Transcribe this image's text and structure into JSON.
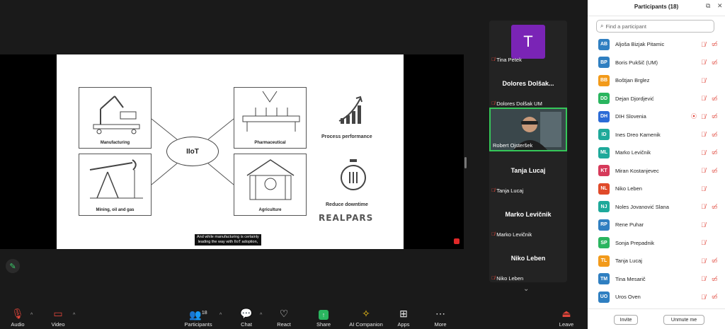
{
  "slide": {
    "boxes": [
      "Manufacturing",
      "Pharmaceutical",
      "Mining, oil and gas",
      "Agriculture"
    ],
    "center": "IIoT",
    "side": [
      "Process performance",
      "Reduce downtime"
    ],
    "brand": "REALPARS",
    "caption_line1": "And while manufacturing is certainly",
    "caption_line2": "leading the way with IIoT adoption,"
  },
  "gallery": {
    "tiles": [
      {
        "avatar": "T",
        "label": "Tina Petek"
      },
      {
        "name": "Dolores  Dolšak...",
        "label": "Dolores Dolšak UM"
      },
      {
        "label": "Robert Ojsteršek"
      },
      {
        "name": "Tanja Lucaj",
        "label": "Tanja Lucaj"
      },
      {
        "name": "Marko Levičnik",
        "label": "Marko Levičnik"
      },
      {
        "name": "Niko Leben",
        "label": "Niko Leben"
      }
    ]
  },
  "toolbar": {
    "audio": "Audio",
    "video": "Video",
    "participants": "Participants",
    "participants_count": "18",
    "chat": "Chat",
    "react": "React",
    "share": "Share",
    "ai": "AI Companion",
    "apps": "Apps",
    "more": "More",
    "leave": "Leave"
  },
  "panel": {
    "title": "Participants (18)",
    "search_placeholder": "Find a participant",
    "invite": "Invite",
    "unmute": "Unmute me",
    "participants": [
      {
        "initials": "AB",
        "name": "Aljoša Bizjak Pitamic",
        "color": "#2f7fc1",
        "cam_off": true
      },
      {
        "initials": "BP",
        "name": "Boris Pukšič (UM)",
        "color": "#2f7fc1",
        "cam_off": true
      },
      {
        "initials": "BB",
        "name": "Boštjan Brglez",
        "color": "#f29a1a",
        "cam_off": false
      },
      {
        "initials": "DD",
        "name": "Dejan Djordjević",
        "color": "#2ab55f",
        "cam_off": true
      },
      {
        "initials": "DH",
        "name": "DIH Slovenia",
        "color": "#2b6bd6",
        "cam_off": true,
        "recording": true
      },
      {
        "initials": "ID",
        "name": "Ines Dreo Kamenik",
        "color": "#1ea99a",
        "cam_off": true
      },
      {
        "initials": "ML",
        "name": "Marko Levičnik",
        "color": "#1ea99a",
        "cam_off": true
      },
      {
        "initials": "KT",
        "name": "Miran Kostanjevec",
        "color": "#d63a5a",
        "cam_off": true
      },
      {
        "initials": "NL",
        "name": "Niko Leben",
        "color": "#e04a2a",
        "cam_off": false
      },
      {
        "initials": "NJ",
        "name": "Noles Jovanović Slana",
        "color": "#1ea99a",
        "cam_off": true
      },
      {
        "initials": "RP",
        "name": "Rene Puhar",
        "color": "#2f7fc1",
        "cam_off": false
      },
      {
        "initials": "SP",
        "name": "Sonja Prepadnik",
        "color": "#2ab55f",
        "cam_off": false
      },
      {
        "initials": "TL",
        "name": "Tanja Lucaj",
        "color": "#f29a1a",
        "cam_off": true
      },
      {
        "initials": "TM",
        "name": "Tina Mesarič",
        "color": "#2f7fc1",
        "cam_off": true
      },
      {
        "initials": "UO",
        "name": "Uros Oven",
        "color": "#2f7fc1",
        "cam_off": true
      }
    ]
  }
}
